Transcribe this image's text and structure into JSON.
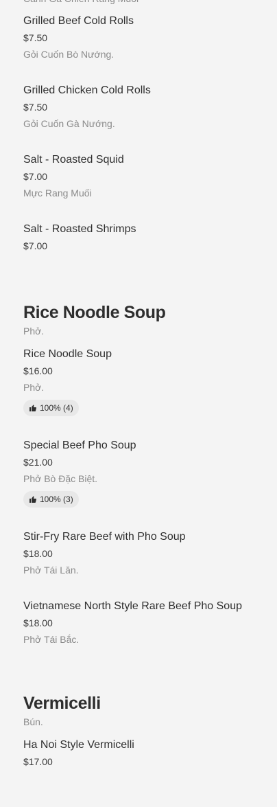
{
  "items_top": [
    {
      "name": "",
      "price": "",
      "desc": "Cánh Gà Chiên Rang Muối"
    },
    {
      "name": "Grilled Beef Cold Rolls",
      "price": "$7.50",
      "desc": "Gỏi Cuốn Bò Nướng."
    },
    {
      "name": "Grilled Chicken Cold Rolls",
      "price": "$7.50",
      "desc": "Gỏi Cuốn Gà Nướng."
    },
    {
      "name": "Salt - Roasted Squid",
      "price": "$7.00",
      "desc": "Mực Rang Muối"
    },
    {
      "name": "Salt - Roasted Shrimps",
      "price": "$7.00",
      "desc": ""
    }
  ],
  "sections": [
    {
      "title": "Rice Noodle Soup",
      "subtitle": "Phở.",
      "items": [
        {
          "name": "Rice Noodle Soup",
          "price": "$16.00",
          "desc": "Phở.",
          "rating": "100% (4)"
        },
        {
          "name": "Special Beef Pho Soup",
          "price": "$21.00",
          "desc": "Phở Bò Đặc Biệt.",
          "rating": "100% (3)"
        },
        {
          "name": "Stir-Fry Rare Beef with Pho Soup",
          "price": "$18.00",
          "desc": "Phở Tái Lăn."
        },
        {
          "name": "Vietnamese North Style Rare Beef Pho Soup",
          "price": "$18.00",
          "desc": "Phở Tái Bắc."
        }
      ]
    },
    {
      "title": "Vermicelli",
      "subtitle": "Bún.",
      "items": [
        {
          "name": "Ha Noi Style Vermicelli",
          "price": "$17.00",
          "desc": ""
        }
      ]
    }
  ],
  "icons": {
    "rating": "thumbs-up-icon"
  }
}
